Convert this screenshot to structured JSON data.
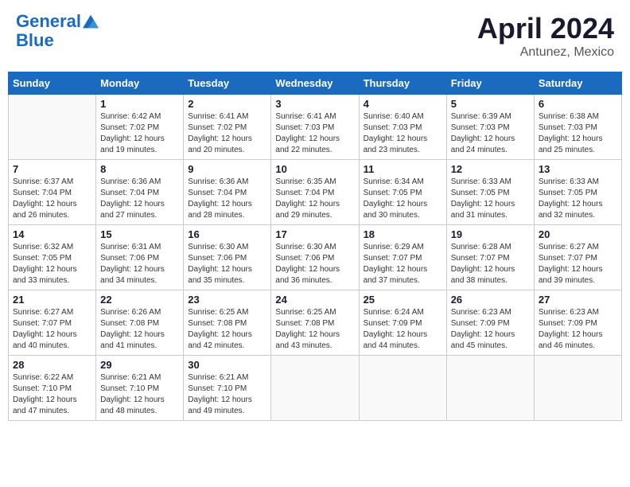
{
  "header": {
    "logo_line1": "General",
    "logo_line2": "Blue",
    "month_title": "April 2024",
    "subtitle": "Antunez, Mexico"
  },
  "days_of_week": [
    "Sunday",
    "Monday",
    "Tuesday",
    "Wednesday",
    "Thursday",
    "Friday",
    "Saturday"
  ],
  "weeks": [
    [
      {
        "day": "",
        "info": ""
      },
      {
        "day": "1",
        "info": "Sunrise: 6:42 AM\nSunset: 7:02 PM\nDaylight: 12 hours\nand 19 minutes."
      },
      {
        "day": "2",
        "info": "Sunrise: 6:41 AM\nSunset: 7:02 PM\nDaylight: 12 hours\nand 20 minutes."
      },
      {
        "day": "3",
        "info": "Sunrise: 6:41 AM\nSunset: 7:03 PM\nDaylight: 12 hours\nand 22 minutes."
      },
      {
        "day": "4",
        "info": "Sunrise: 6:40 AM\nSunset: 7:03 PM\nDaylight: 12 hours\nand 23 minutes."
      },
      {
        "day": "5",
        "info": "Sunrise: 6:39 AM\nSunset: 7:03 PM\nDaylight: 12 hours\nand 24 minutes."
      },
      {
        "day": "6",
        "info": "Sunrise: 6:38 AM\nSunset: 7:03 PM\nDaylight: 12 hours\nand 25 minutes."
      }
    ],
    [
      {
        "day": "7",
        "info": "Sunrise: 6:37 AM\nSunset: 7:04 PM\nDaylight: 12 hours\nand 26 minutes."
      },
      {
        "day": "8",
        "info": "Sunrise: 6:36 AM\nSunset: 7:04 PM\nDaylight: 12 hours\nand 27 minutes."
      },
      {
        "day": "9",
        "info": "Sunrise: 6:36 AM\nSunset: 7:04 PM\nDaylight: 12 hours\nand 28 minutes."
      },
      {
        "day": "10",
        "info": "Sunrise: 6:35 AM\nSunset: 7:04 PM\nDaylight: 12 hours\nand 29 minutes."
      },
      {
        "day": "11",
        "info": "Sunrise: 6:34 AM\nSunset: 7:05 PM\nDaylight: 12 hours\nand 30 minutes."
      },
      {
        "day": "12",
        "info": "Sunrise: 6:33 AM\nSunset: 7:05 PM\nDaylight: 12 hours\nand 31 minutes."
      },
      {
        "day": "13",
        "info": "Sunrise: 6:33 AM\nSunset: 7:05 PM\nDaylight: 12 hours\nand 32 minutes."
      }
    ],
    [
      {
        "day": "14",
        "info": "Sunrise: 6:32 AM\nSunset: 7:05 PM\nDaylight: 12 hours\nand 33 minutes."
      },
      {
        "day": "15",
        "info": "Sunrise: 6:31 AM\nSunset: 7:06 PM\nDaylight: 12 hours\nand 34 minutes."
      },
      {
        "day": "16",
        "info": "Sunrise: 6:30 AM\nSunset: 7:06 PM\nDaylight: 12 hours\nand 35 minutes."
      },
      {
        "day": "17",
        "info": "Sunrise: 6:30 AM\nSunset: 7:06 PM\nDaylight: 12 hours\nand 36 minutes."
      },
      {
        "day": "18",
        "info": "Sunrise: 6:29 AM\nSunset: 7:07 PM\nDaylight: 12 hours\nand 37 minutes."
      },
      {
        "day": "19",
        "info": "Sunrise: 6:28 AM\nSunset: 7:07 PM\nDaylight: 12 hours\nand 38 minutes."
      },
      {
        "day": "20",
        "info": "Sunrise: 6:27 AM\nSunset: 7:07 PM\nDaylight: 12 hours\nand 39 minutes."
      }
    ],
    [
      {
        "day": "21",
        "info": "Sunrise: 6:27 AM\nSunset: 7:07 PM\nDaylight: 12 hours\nand 40 minutes."
      },
      {
        "day": "22",
        "info": "Sunrise: 6:26 AM\nSunset: 7:08 PM\nDaylight: 12 hours\nand 41 minutes."
      },
      {
        "day": "23",
        "info": "Sunrise: 6:25 AM\nSunset: 7:08 PM\nDaylight: 12 hours\nand 42 minutes."
      },
      {
        "day": "24",
        "info": "Sunrise: 6:25 AM\nSunset: 7:08 PM\nDaylight: 12 hours\nand 43 minutes."
      },
      {
        "day": "25",
        "info": "Sunrise: 6:24 AM\nSunset: 7:09 PM\nDaylight: 12 hours\nand 44 minutes."
      },
      {
        "day": "26",
        "info": "Sunrise: 6:23 AM\nSunset: 7:09 PM\nDaylight: 12 hours\nand 45 minutes."
      },
      {
        "day": "27",
        "info": "Sunrise: 6:23 AM\nSunset: 7:09 PM\nDaylight: 12 hours\nand 46 minutes."
      }
    ],
    [
      {
        "day": "28",
        "info": "Sunrise: 6:22 AM\nSunset: 7:10 PM\nDaylight: 12 hours\nand 47 minutes."
      },
      {
        "day": "29",
        "info": "Sunrise: 6:21 AM\nSunset: 7:10 PM\nDaylight: 12 hours\nand 48 minutes."
      },
      {
        "day": "30",
        "info": "Sunrise: 6:21 AM\nSunset: 7:10 PM\nDaylight: 12 hours\nand 49 minutes."
      },
      {
        "day": "",
        "info": ""
      },
      {
        "day": "",
        "info": ""
      },
      {
        "day": "",
        "info": ""
      },
      {
        "day": "",
        "info": ""
      }
    ]
  ]
}
